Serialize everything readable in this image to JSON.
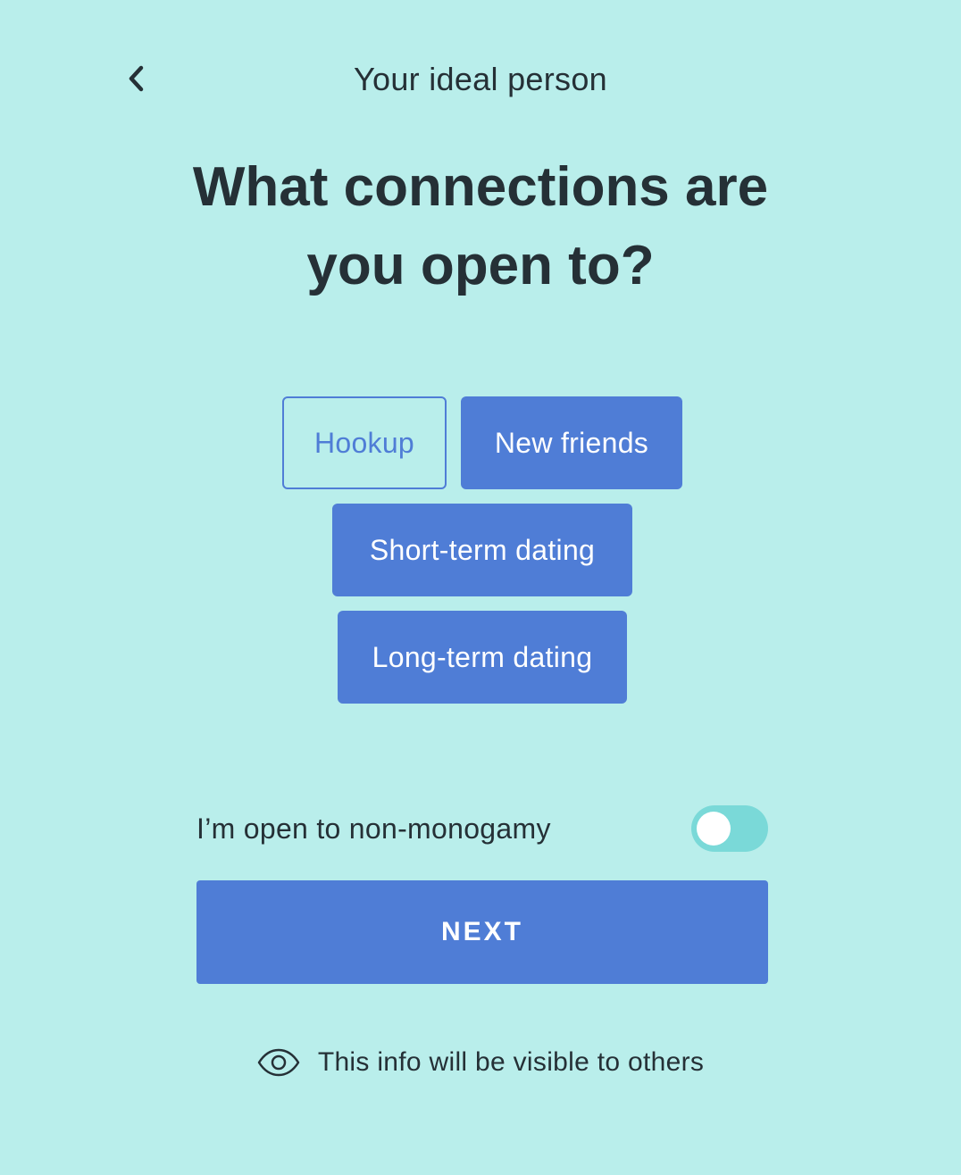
{
  "header": {
    "back_icon": "chevron-left-icon",
    "title": "Your ideal person"
  },
  "question": {
    "line1": "What connections are",
    "line2": "you open to?"
  },
  "options": [
    {
      "label": "Hookup",
      "selected": false
    },
    {
      "label": "New friends",
      "selected": true
    },
    {
      "label": "Short-term dating",
      "selected": true
    },
    {
      "label": "Long-term dating",
      "selected": true
    }
  ],
  "non_monogamy": {
    "label": "I’m open to non-monogamy",
    "enabled": false
  },
  "next_button": {
    "label": "NEXT"
  },
  "visibility": {
    "icon": "eye-icon",
    "text": "This info will be visible to others"
  },
  "colors": {
    "background": "#b9eeeb",
    "accent": "#4f7dd6",
    "text": "#253036",
    "toggle_track": "#7ad9d8"
  }
}
